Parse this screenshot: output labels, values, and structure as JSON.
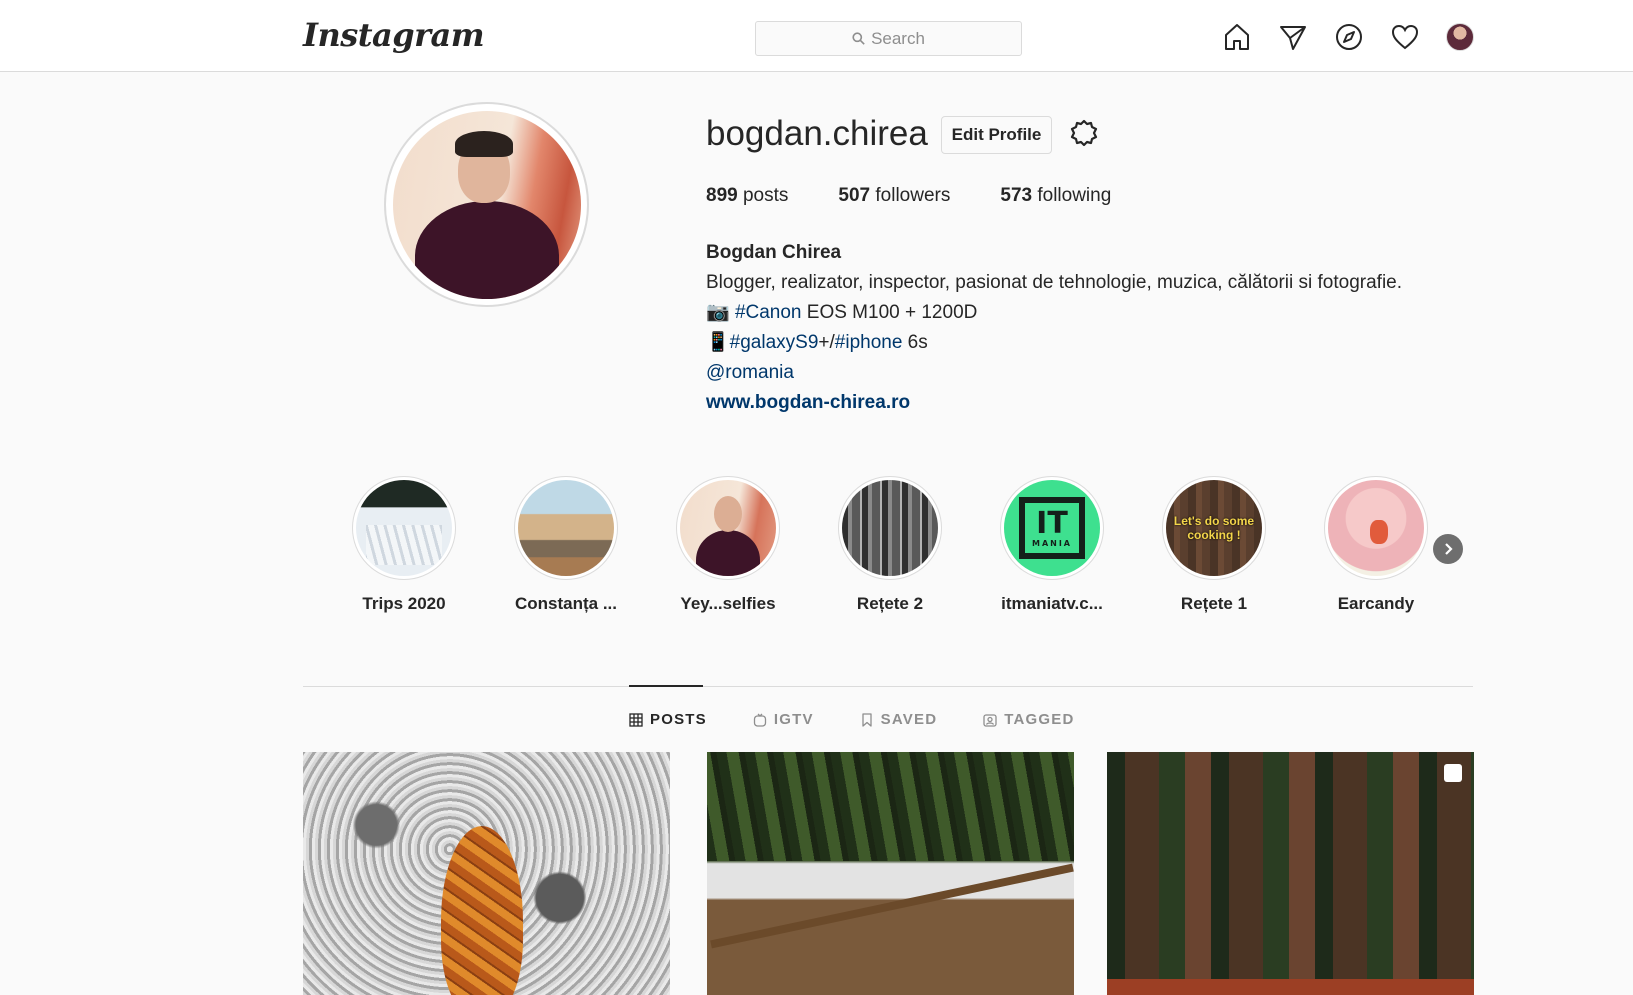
{
  "nav": {
    "logo": "Instagram",
    "search_placeholder": "Search",
    "icons": [
      "home-icon",
      "direct-icon",
      "explore-icon",
      "activity-heart-icon",
      "profile-avatar"
    ]
  },
  "profile": {
    "username": "bogdan.chirea",
    "edit_button": "Edit Profile",
    "stats": {
      "posts_count": "899",
      "posts_label": "posts",
      "followers_count": "507",
      "followers_label": "followers",
      "following_count": "573",
      "following_label": "following"
    },
    "bio": {
      "full_name": "Bogdan Chirea",
      "line1": "Blogger, realizator, inspector, pasionat de tehnologie, muzica, călătorii si fotografie.",
      "line2_prefix": "📷 ",
      "line2_tag": "#Canon",
      "line2_suffix": " EOS M100 + 1200D",
      "line3_prefix": "📱",
      "line3_tag1": "#galaxyS9",
      "line3_mid": "+/",
      "line3_tag2": "#iphone",
      "line3_suffix": " 6s",
      "line4_mention": "@romania",
      "website": "www.bogdan-chirea.ro"
    }
  },
  "highlights": [
    {
      "label": "Trips 2020"
    },
    {
      "label": "Constanța ..."
    },
    {
      "label": "Yey...selfies"
    },
    {
      "label": "Rețete 2"
    },
    {
      "label": "itmaniatv.c..."
    },
    {
      "label": "Rețete 1"
    },
    {
      "label": "Earcandy"
    }
  ],
  "highlight_texts": {
    "it_top": "IT",
    "it_bottom": "MANIA",
    "cooking": "Let's do some cooking !"
  },
  "tabs": [
    {
      "label": "POSTS",
      "icon": "grid-icon",
      "active": true
    },
    {
      "label": "IGTV",
      "icon": "igtv-icon",
      "active": false
    },
    {
      "label": "SAVED",
      "icon": "bookmark-icon",
      "active": false
    },
    {
      "label": "TAGGED",
      "icon": "tagged-icon",
      "active": false
    }
  ],
  "colors": {
    "link": "#00376b",
    "border": "#dbdbdb",
    "text": "#262626",
    "muted": "#8e8e8e"
  }
}
